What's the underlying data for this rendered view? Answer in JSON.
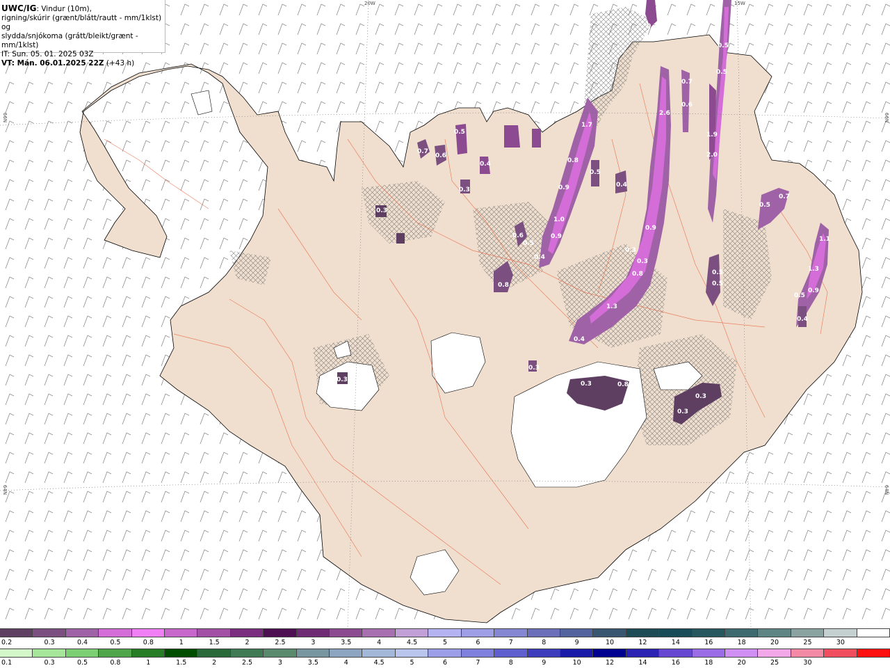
{
  "header": {
    "product": "UWC/IG",
    "desc_line1": ": Vindur (10m),",
    "desc_line2": "rigning/skúrir (grænt/blátt/rautt - mm/1klst) og",
    "desc_line3": "slydda/snjókoma (grátt/bleikt/grænt - mm/1klst)",
    "it": "IT: Sun. 05. 01. 2025 03Z",
    "vt": "VT: Mán. 06.01.2025 22Z",
    "lead": "(+43 h)"
  },
  "grid_labels": [
    "20W",
    "15W",
    "66N",
    "66N",
    "64N",
    "64N"
  ],
  "map_values": [
    "0.3",
    "1.7",
    "2.6",
    "0.5",
    "0.5",
    "1.9",
    "2.0",
    "0.7",
    "0.6",
    "0.7",
    "0.6",
    "0.5",
    "0.3",
    "0.4",
    "0.8",
    "0.5",
    "0.4",
    "0.9",
    "1.0",
    "0.9",
    "0.6",
    "0.5",
    "0.4",
    "0.3",
    "0.3",
    "0.9",
    "0.3",
    "0.8",
    "0.8",
    "1.3",
    "0.4",
    "0.3",
    "0.8",
    "0.3",
    "0.3",
    "0.5",
    "0.5",
    "0.5",
    "0.7",
    "1.1",
    "1.3",
    "0.9",
    "0.5",
    "0.4",
    "0.3",
    "0.3"
  ],
  "legend_top": {
    "labels": [
      "0.2",
      "0.3",
      "0.4",
      "0.5",
      "0.8",
      "1",
      "1.5",
      "2",
      "2.5",
      "3",
      "3.5",
      "4",
      "4.5",
      "5",
      "6",
      "7",
      "8",
      "9",
      "10",
      "12",
      "14",
      "16",
      "18",
      "20",
      "25",
      "30"
    ],
    "colors": [
      "#5e3f62",
      "#7b4f80",
      "#a062a6",
      "#d46dd8",
      "#f07ef4",
      "#c767cb",
      "#a24fa6",
      "#7a2d7f",
      "#4e0f52",
      "#6e2b73",
      "#8c4a90",
      "#a86fb0",
      "#c1a0d8",
      "#b5b2f2",
      "#9d9ee6",
      "#8587d2",
      "#6b6fba",
      "#52639e",
      "#38566f",
      "#1c4a55",
      "#174b57",
      "#26575f",
      "#3d6a6f",
      "#5e8584",
      "#8aa3a1",
      "#c3d0cf",
      "#ffffff"
    ]
  },
  "legend_bottom": {
    "labels": [
      "0.1",
      "0.3",
      "0.5",
      "0.8",
      "1",
      "1.5",
      "2",
      "2.5",
      "3",
      "3.5",
      "4",
      "4.5",
      "5",
      "6",
      "7",
      "8",
      "9",
      "10",
      "12",
      "14",
      "16",
      "18",
      "20",
      "25",
      "30"
    ],
    "colors": [
      "#d4f7c9",
      "#a5e69a",
      "#7ccf72",
      "#4ea54a",
      "#267d25",
      "#004d00",
      "#2a6a3a",
      "#3f7a55",
      "#5a8a6e",
      "#7896a0",
      "#8ea5c2",
      "#a3b7d8",
      "#b9c5ec",
      "#9c9ee8",
      "#7f80dd",
      "#5f5fd0",
      "#3c3cbd",
      "#1a1aa8",
      "#000090",
      "#2b22b3",
      "#6547d2",
      "#9a6de7",
      "#cf8ff3",
      "#f2a8e8",
      "#f28aa6",
      "#f04e5e",
      "#ff1010"
    ]
  }
}
